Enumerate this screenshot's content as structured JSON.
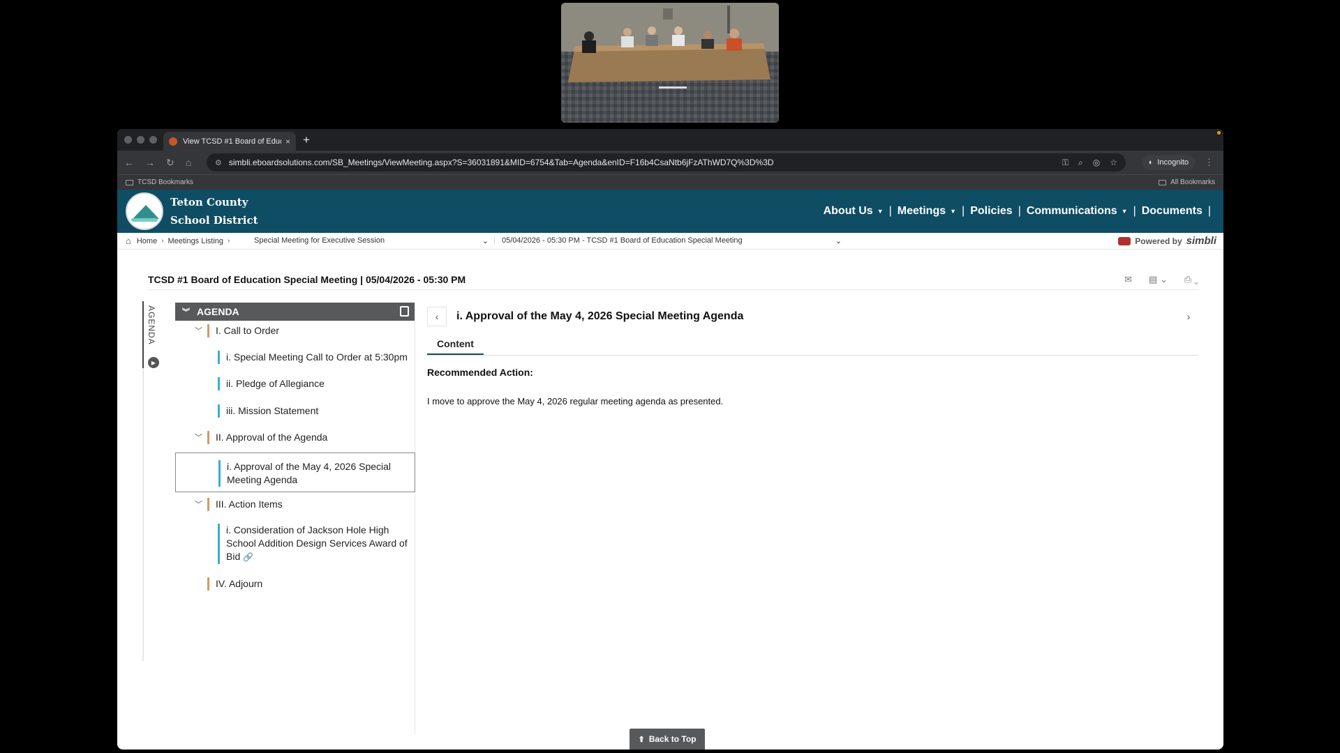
{
  "browser": {
    "tab_title": "View TCSD #1 Board of Educ",
    "tab_close": "×",
    "new_tab": "+",
    "url": "simbli.eboardsolutions.com/SB_Meetings/ViewMeeting.aspx?S=36031891&MID=6754&Tab=Agenda&enID=F16b4CsaNtb6jFzAThWD7Q%3D%3D",
    "incognito_label": "Incognito",
    "bookmarks_left": "TCSD Bookmarks",
    "bookmarks_right": "All Bookmarks"
  },
  "site": {
    "brand_line1": "Teton County",
    "brand_line2": "School District",
    "nav": {
      "about": "About Us",
      "meetings": "Meetings",
      "policies": "Policies",
      "communications": "Communications",
      "documents": "Documents"
    }
  },
  "breadcrumb": {
    "home": "Home",
    "meetings_listing": "Meetings Listing",
    "meeting_type": "Special Meeting for Executive Session",
    "meeting_select": "05/04/2026 - 05:30 PM - TCSD #1 Board of Education Special Meeting",
    "powered_by": "Powered by",
    "powered_brand": "simbli"
  },
  "meeting": {
    "title": "TCSD #1 Board of Education Special Meeting | 05/04/2026 - 05:30 PM"
  },
  "side_tab": {
    "label": "AGENDA"
  },
  "agenda": {
    "header": "AGENDA",
    "items": [
      {
        "label": "I. Call to Order"
      },
      {
        "label": "i. Special Meeting Call to Order at 5:30pm"
      },
      {
        "label": "ii. Pledge of Allegiance"
      },
      {
        "label": "iii. Mission Statement"
      },
      {
        "label": "II. Approval of the Agenda"
      },
      {
        "label": "i. Approval of the May 4, 2026 Special Meeting Agenda"
      },
      {
        "label": "III. Action Items"
      },
      {
        "label": "i. Consideration of Jackson Hole High School Addition Design Services Award of Bid"
      },
      {
        "label": "IV. Adjourn"
      }
    ]
  },
  "content": {
    "title": "i. Approval of the May 4, 2026 Special Meeting Agenda",
    "tab_label": "Content",
    "recommended_label": "Recommended Action:",
    "recommended_text": "I move to approve the May 4, 2026 regular meeting agenda as presented."
  },
  "back_to_top": "Back to Top",
  "colors": {
    "header_bg": "#0e4d63",
    "agenda_header_bg": "#58595b",
    "section_accent": "#d49a66",
    "item_accent": "#3aaed0"
  }
}
